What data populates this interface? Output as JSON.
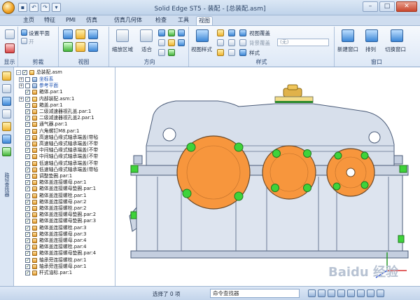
{
  "window": {
    "title": "Solid Edge ST5 - 装配 - [总装配.asm]"
  },
  "tabs": [
    {
      "label": "主页"
    },
    {
      "label": "特征"
    },
    {
      "label": "PMI"
    },
    {
      "label": "仿真"
    },
    {
      "label": "仿真几何体"
    },
    {
      "label": "检查"
    },
    {
      "label": "工具"
    },
    {
      "label": "视图",
      "active": true
    }
  ],
  "ribbon": {
    "display_group": {
      "label": "显示"
    },
    "plane_group": {
      "label": "剪裁",
      "set_plane": "设置平面",
      "open": "开"
    },
    "view_group": {
      "label": "视图"
    },
    "direction_group": {
      "label": "方向",
      "zoom_area": "缩放区域",
      "fit": "适合"
    },
    "style_group": {
      "label": "样式",
      "view_style": "视图样式",
      "view_overlay": "视图覆盖",
      "background": "背景覆盖",
      "style": "样式",
      "none_option": "(无)"
    },
    "window_group": {
      "label": "窗口",
      "new_window": "新建窗口",
      "arrange": "排列",
      "switch_window": "切换窗口"
    }
  },
  "left_strip": {
    "label": "路径查找器"
  },
  "tree": {
    "root": "总装配.asm",
    "items": [
      {
        "label": "坐标系",
        "kind": "ref",
        "checked": false,
        "indent": 1,
        "link": true
      },
      {
        "label": "参考平面",
        "kind": "ref",
        "checked": false,
        "indent": 1,
        "link": true
      },
      {
        "label": "箱体.par:1",
        "kind": "part",
        "checked": true,
        "indent": 1
      },
      {
        "label": "内部装配.asm:1",
        "kind": "asm",
        "checked": true,
        "indent": 1
      },
      {
        "label": "箱盖.par:1",
        "kind": "part",
        "checked": true,
        "indent": 1
      },
      {
        "label": "二级减速器视孔盖.par:1",
        "kind": "part",
        "checked": true,
        "indent": 1
      },
      {
        "label": "二级减速器视孔盖2.par:1",
        "kind": "part",
        "checked": true,
        "indent": 1
      },
      {
        "label": "通气器.par:1",
        "kind": "part",
        "checked": true,
        "indent": 1
      },
      {
        "label": "六角螺钉M8.par:1",
        "kind": "part",
        "checked": true,
        "indent": 1
      },
      {
        "label": "高速轴凸缘式轴承端盖(带毡",
        "kind": "part",
        "checked": true,
        "indent": 1
      },
      {
        "label": "高速轴凸缘式轴承端盖(不带",
        "kind": "part",
        "checked": true,
        "indent": 1
      },
      {
        "label": "中间轴凸缘式轴承端盖(不带",
        "kind": "part",
        "checked": true,
        "indent": 1
      },
      {
        "label": "中间轴凸缘式轴承端盖(不带",
        "kind": "part",
        "checked": true,
        "indent": 1
      },
      {
        "label": "低速轴凸缘式轴承端盖(不带",
        "kind": "part",
        "checked": true,
        "indent": 1
      },
      {
        "label": "低速轴凸缘式轴承端盖(带毡",
        "kind": "part",
        "checked": true,
        "indent": 1
      },
      {
        "label": "调整垫圈.par:1",
        "kind": "part",
        "checked": true,
        "indent": 1
      },
      {
        "label": "箱体盖连接螺母.par:1",
        "kind": "part",
        "checked": true,
        "indent": 1
      },
      {
        "label": "箱体盖连接螺母垫圈.par:1",
        "kind": "part",
        "checked": true,
        "indent": 1
      },
      {
        "label": "箱体盖连接螺栓.par:1",
        "kind": "part",
        "checked": true,
        "indent": 1
      },
      {
        "label": "箱体盖连接螺母.par:2",
        "kind": "part",
        "checked": true,
        "indent": 1
      },
      {
        "label": "箱体盖连接螺栓.par:2",
        "kind": "part",
        "checked": true,
        "indent": 1
      },
      {
        "label": "箱体盖连接螺母垫圈.par:2",
        "kind": "part",
        "checked": true,
        "indent": 1
      },
      {
        "label": "箱体盖连接螺母垫圈.par:3",
        "kind": "part",
        "checked": true,
        "indent": 1
      },
      {
        "label": "箱体盖连接螺栓.par:3",
        "kind": "part",
        "checked": true,
        "indent": 1
      },
      {
        "label": "箱体盖连接螺母.par:3",
        "kind": "part",
        "checked": true,
        "indent": 1
      },
      {
        "label": "箱体盖连接螺母.par:4",
        "kind": "part",
        "checked": true,
        "indent": 1
      },
      {
        "label": "箱体盖连接螺栓.par:4",
        "kind": "part",
        "checked": true,
        "indent": 1
      },
      {
        "label": "箱体盖连接螺母垫圈.par:4",
        "kind": "part",
        "checked": true,
        "indent": 1
      },
      {
        "label": "轴承旁连接螺栓.par:1",
        "kind": "part",
        "checked": true,
        "indent": 1
      },
      {
        "label": "轴承旁连接螺母.par:1",
        "kind": "part",
        "checked": true,
        "indent": 1
      },
      {
        "label": "杆式油标.par:1",
        "kind": "part",
        "checked": true,
        "indent": 1
      }
    ]
  },
  "status_bar": {
    "selection": "选择了 0 项",
    "command_finder": "命令查找器"
  },
  "watermark": "Baidu 经验",
  "colors": {
    "ribbon_bg": "#dde8f6",
    "part_orange": "#f7963d",
    "bolt_green": "#3fd33a",
    "housing_grey": "#d4dbe7"
  }
}
